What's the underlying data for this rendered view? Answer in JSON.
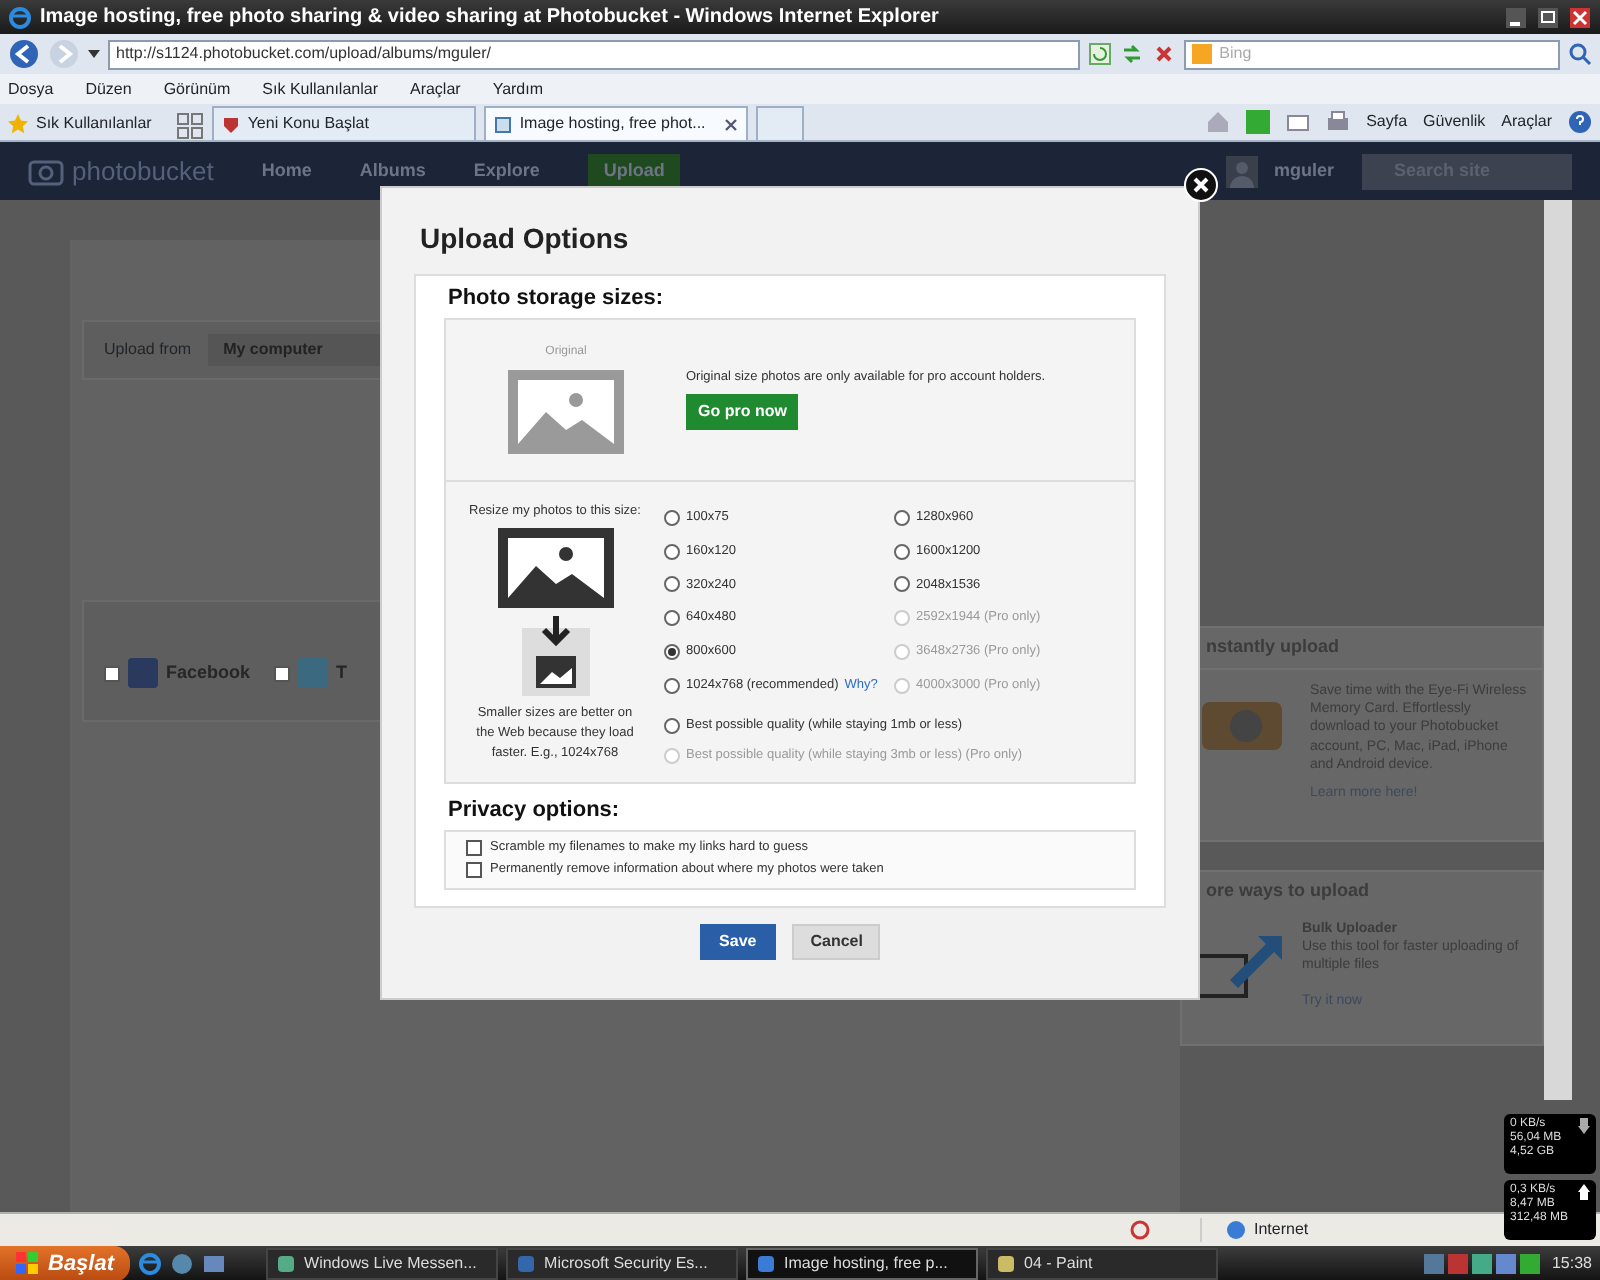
{
  "window": {
    "title": "Image hosting, free photo sharing & video sharing at Photobucket - Windows Internet Explorer"
  },
  "address_bar": {
    "url": "http://s1124.photobucket.com/upload/albums/mguler/",
    "search_placeholder": "Bing"
  },
  "menu": [
    "Dosya",
    "Düzen",
    "Görünüm",
    "Sık Kullanılanlar",
    "Araçlar",
    "Yardım"
  ],
  "favorites_label": "Sık Kullanılanlar",
  "tabs": [
    {
      "label": "Yeni Konu Başlat",
      "selected": false
    },
    {
      "label": "Image hosting, free phot...",
      "selected": true
    }
  ],
  "command_bar": [
    "Sayfa",
    "Güvenlik",
    "Araçlar"
  ],
  "site": {
    "logo": "photobucket",
    "nav": [
      {
        "label": "Home",
        "selected": false
      },
      {
        "label": "Albums",
        "selected": false
      },
      {
        "label": "Explore",
        "selected": false
      },
      {
        "label": "Upload",
        "selected": true
      }
    ],
    "user": "mguler",
    "search_placeholder": "Search site",
    "upload_from_label": "Upload from",
    "upload_from_value": "My computer",
    "share": [
      {
        "label": "Facebook",
        "checked": false
      },
      {
        "label": "T",
        "checked": false
      }
    ],
    "eyefi": {
      "title": "nstantly upload",
      "text": "Save time with the Eye-Fi Wireless Memory Card. Effortlessly download to your Photobucket account, PC, Mac, iPad, iPhone and Android device.",
      "link": "Learn more here!"
    },
    "more": {
      "title": "ore ways to upload",
      "name": "Bulk Uploader",
      "text": "Use this tool for faster uploading of multiple files",
      "link": "Try it now"
    }
  },
  "dialog": {
    "title": "Upload Options",
    "storage_heading": "Photo storage sizes:",
    "original_caption": "Original",
    "original_text": "Original size photos are only available for pro account holders.",
    "go_pro": "Go pro now",
    "resize_label": "Resize my photos to this size:",
    "resize_note": "Smaller sizes are better on the Web because they load faster. E.g., 1024x768",
    "sizes": [
      {
        "label": "100x75",
        "selected": false,
        "disabled": false
      },
      {
        "label": "1280x960",
        "selected": false,
        "disabled": false
      },
      {
        "label": "160x120",
        "selected": false,
        "disabled": false
      },
      {
        "label": "1600x1200",
        "selected": false,
        "disabled": false
      },
      {
        "label": "320x240",
        "selected": false,
        "disabled": false
      },
      {
        "label": "2048x1536",
        "selected": false,
        "disabled": false
      },
      {
        "label": "640x480",
        "selected": false,
        "disabled": false
      },
      {
        "label": "2592x1944 (Pro only)",
        "selected": false,
        "disabled": true
      },
      {
        "label": "800x600",
        "selected": true,
        "disabled": false
      },
      {
        "label": "3648x2736 (Pro only)",
        "selected": false,
        "disabled": true
      },
      {
        "label": "1024x768 (recommended)",
        "link": "Why?",
        "selected": false,
        "disabled": false
      },
      {
        "label": "4000x3000 (Pro only)",
        "selected": false,
        "disabled": true
      }
    ],
    "quality": [
      {
        "label": "Best possible quality (while staying 1mb or less)",
        "selected": false,
        "disabled": false
      },
      {
        "label": "Best possible quality (while staying 3mb or less) (Pro only)",
        "selected": false,
        "disabled": true
      }
    ],
    "privacy_heading": "Privacy options:",
    "privacy": [
      {
        "label": "Scramble my filenames to make my links hard to guess",
        "checked": false
      },
      {
        "label": "Permanently remove information about where my photos were taken",
        "checked": false
      }
    ],
    "buttons": [
      {
        "label": "Save",
        "kind": "primary"
      },
      {
        "label": "Cancel",
        "kind": "secondary"
      }
    ]
  },
  "status_bar": {
    "zone": "Internet"
  },
  "net_meter": [
    {
      "kind": "download",
      "lines": [
        "0 KB/s",
        "56,04 MB",
        "4,52 GB"
      ]
    },
    {
      "kind": "upload",
      "lines": [
        "0,3 KB/s",
        "8,47 MB",
        "312,48 MB"
      ]
    }
  ],
  "taskbar": {
    "start": "Başlat",
    "items": [
      {
        "label": "Windows Live Messen...",
        "selected": false
      },
      {
        "label": "Microsoft Security Es...",
        "selected": false
      },
      {
        "label": "Image hosting, free p...",
        "selected": true
      },
      {
        "label": "04 - Paint",
        "selected": false
      }
    ],
    "clock": "15:38"
  }
}
